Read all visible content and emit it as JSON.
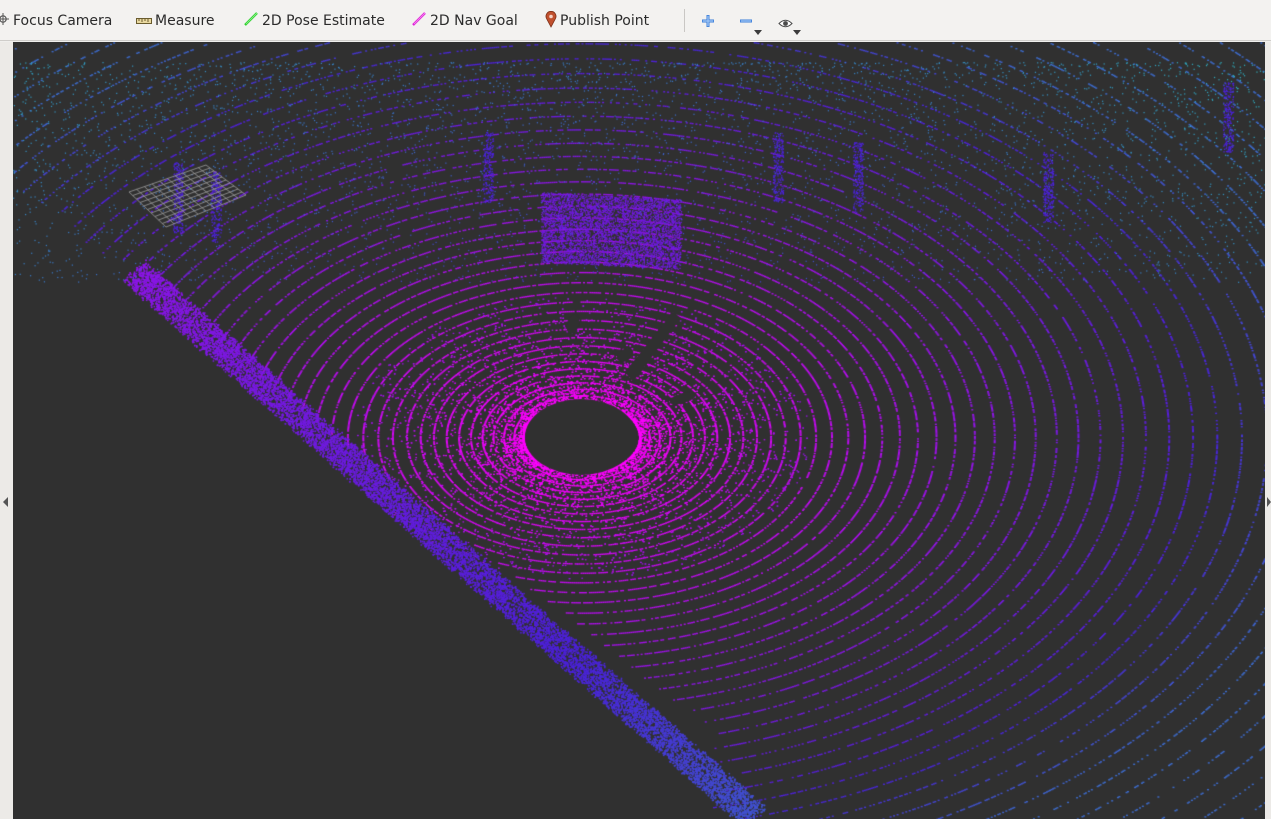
{
  "toolbar": {
    "focus_camera": "Focus Camera",
    "measure": "Measure",
    "pose_estimate": "2D Pose Estimate",
    "nav_goal": "2D Nav Goal",
    "publish_point": "Publish Point"
  },
  "icons": {
    "focus_camera": "focus-camera-icon",
    "measure": "ruler-icon",
    "pose_estimate": "green-arrow-icon",
    "nav_goal": "magenta-arrow-icon",
    "publish_point": "map-pin-icon",
    "add": "plus-icon",
    "remove": "minus-icon",
    "view": "eye-icon"
  },
  "colors": {
    "viewport_background": "#303030",
    "point_near": "#ff00ff",
    "point_far": "#4b22d8",
    "point_farthest": "#2fb7c4",
    "grid": "#a0a0a0",
    "pose_arrow": "#2fd12f",
    "nav_arrow": "#e020d8",
    "pin": "#c0502e",
    "accent_blue": "#3b7dd8"
  }
}
